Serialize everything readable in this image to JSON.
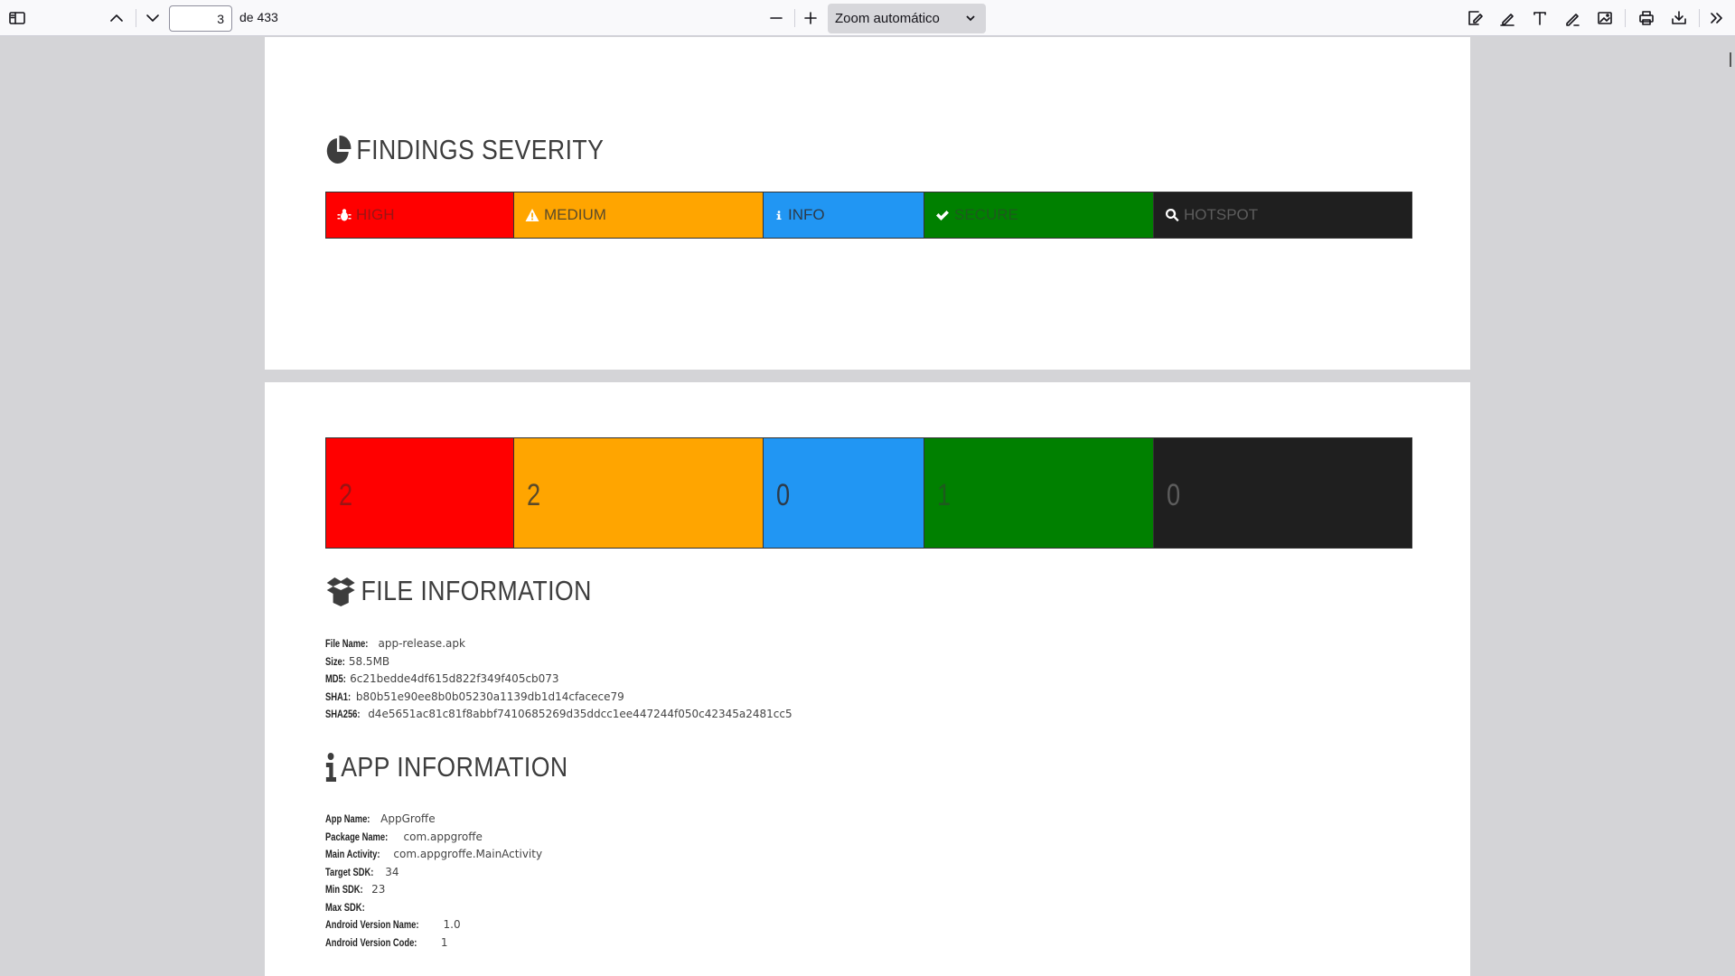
{
  "toolbar": {
    "page_current": "3",
    "page_total_label": "de 433",
    "zoom_label": "Zoom automático",
    "icons": [
      "sidebar-toggle-icon",
      "previous-page-icon",
      "next-page-icon",
      "zoom-out-icon",
      "zoom-in-icon",
      "chevron-down-icon",
      "signature-icon",
      "highlight-icon",
      "text-icon",
      "draw-icon",
      "image-icon",
      "print-icon",
      "download-icon",
      "tools-menu-icon"
    ]
  },
  "findings": {
    "title": "FINDINGS SEVERITY",
    "labels": {
      "high": "HIGH",
      "medium": "MEDIUM",
      "info": "INFO",
      "secure": "SECURE",
      "hotspot": "HOTSPOT"
    },
    "counts": {
      "high": "2",
      "medium": "2",
      "info": "0",
      "secure": "1",
      "hotspot": "0"
    },
    "colors": {
      "high": "#ff0000",
      "medium": "#ffa500",
      "info": "#2196f3",
      "secure": "#008000",
      "hotspot": "#1f1f1f"
    }
  },
  "file_info": {
    "title": "FILE INFORMATION",
    "rows": [
      {
        "key": "File Name:",
        "value": "app-release.apk"
      },
      {
        "key": "Size:",
        "value": "58.5MB"
      },
      {
        "key": "MD5:",
        "value": "6c21bedde4df615d822f349f405cb073"
      },
      {
        "key": "SHA1:",
        "value": "b80b51e90ee8b0b05230a1139db1d14cfacece79"
      },
      {
        "key": "SHA256:",
        "value": "d4e5651ac81c81f8abbf7410685269d35ddcc1ee447244f050c42345a2481cc5"
      }
    ]
  },
  "app_info": {
    "title": "APP INFORMATION",
    "rows": [
      {
        "key": "App Name:",
        "value": "AppGroffe"
      },
      {
        "key": "Package Name:",
        "value": "com.appgroffe"
      },
      {
        "key": "Main Activity:",
        "value": "com.appgroffe.MainActivity"
      },
      {
        "key": "Target SDK:",
        "value": "34"
      },
      {
        "key": "Min SDK:",
        "value": "23"
      },
      {
        "key": "Max SDK:",
        "value": ""
      },
      {
        "key": "Android Version Name:",
        "value": "1.0"
      },
      {
        "key": "Android Version Code:",
        "value": "1"
      }
    ]
  }
}
